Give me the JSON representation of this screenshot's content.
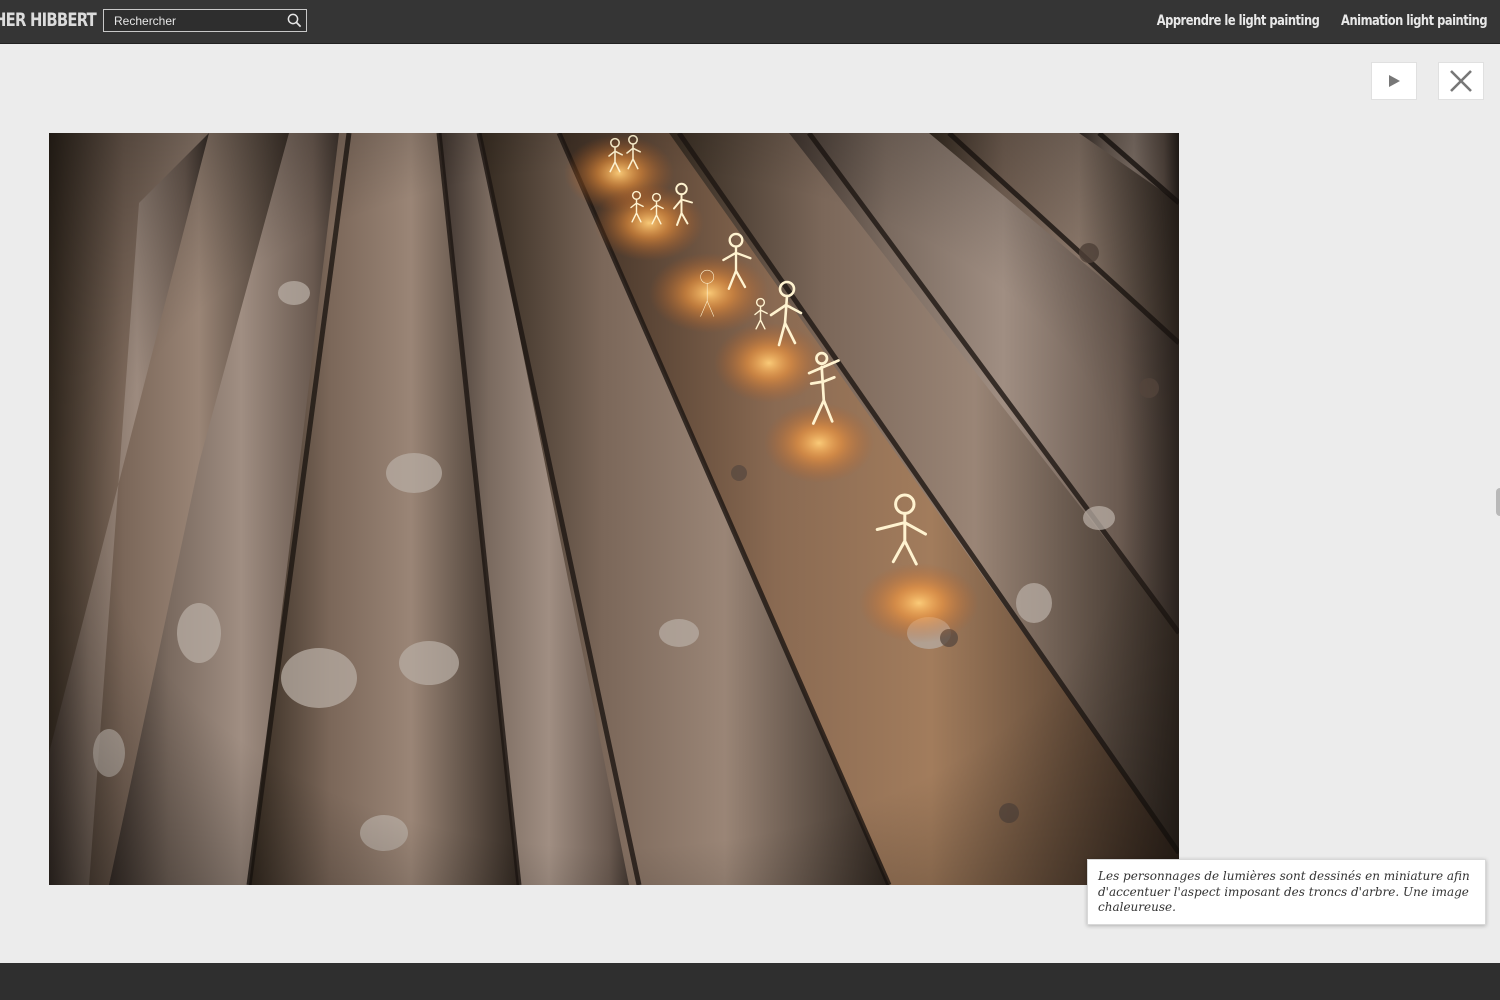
{
  "header": {
    "brand": "HER HIBBERT",
    "search_placeholder": "Rechercher",
    "nav": [
      {
        "label": "Apprendre le light painting"
      },
      {
        "label": "Animation light painting"
      }
    ]
  },
  "lightbox": {
    "caption": "Les personnages de lumières sont dessinés en miniature afin d'accentuer l'aspect imposant des troncs d'arbre. Une image chaleureuse.",
    "photo_subject": "light-painted stick figures walking on stacked tree logs"
  },
  "colors": {
    "topbar": "#353535",
    "page_background": "#ececec",
    "footer": "#2f2f2f",
    "glow": "#ffb24a"
  }
}
